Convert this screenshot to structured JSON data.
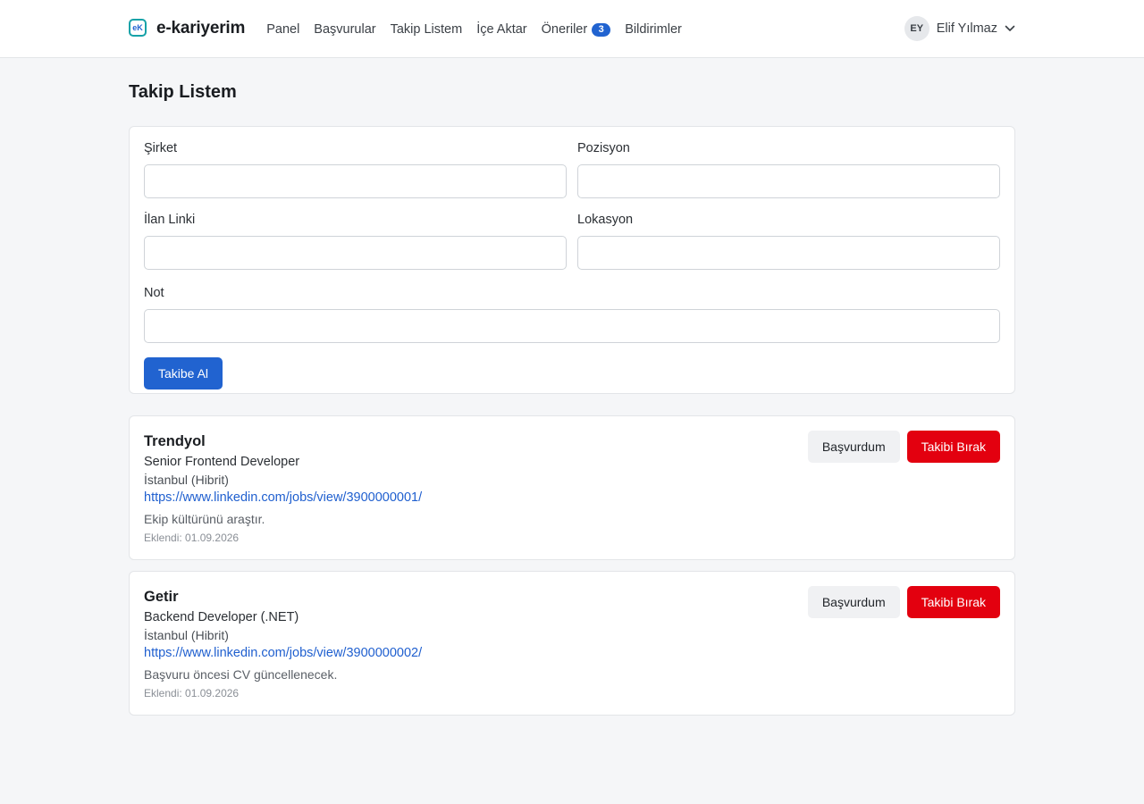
{
  "brand": {
    "logo_text": "eK",
    "name": "e-kariyerim"
  },
  "nav": {
    "items": [
      "Panel",
      "Başvurular",
      "Takip Listem",
      "İçe Aktar",
      "Öneriler",
      "Bildirimler"
    ],
    "recommendations_count": "3"
  },
  "user": {
    "initials": "EY",
    "name": "Elif Yılmaz"
  },
  "page": {
    "title": "Takip Listem"
  },
  "form": {
    "company_label": "Şirket",
    "company_value": "",
    "position_label": "Pozisyon",
    "position_value": "",
    "link_label": "İlan Linki",
    "link_value": "",
    "location_label": "Lokasyon",
    "location_value": "",
    "note_label": "Not",
    "note_value": "",
    "submit_label": "Takibe Al"
  },
  "watchlist": [
    {
      "company": "Trendyol",
      "position": "Senior Frontend Developer",
      "location": "İstanbul (Hibrit)",
      "link": "https://www.linkedin.com/jobs/view/3900000001/",
      "note": "Ekip kültürünü araştır.",
      "added": "Eklendi: 01.09.2026",
      "applied_label": "Başvurdum",
      "unfollow_label": "Takibi Bırak"
    },
    {
      "company": "Getir",
      "position": "Backend Developer (.NET)",
      "location": "İstanbul (Hibrit)",
      "link": "https://www.linkedin.com/jobs/view/3900000002/",
      "note": "Başvuru öncesi CV güncellenecek.",
      "added": "Eklendi: 01.09.2026",
      "applied_label": "Başvurdum",
      "unfollow_label": "Takibi Bırak"
    }
  ],
  "colors": {
    "primary": "#2163d0",
    "danger": "#e3000f",
    "background": "#f5f6f8"
  },
  "icons": {
    "user_menu": "chevron-down-icon"
  }
}
